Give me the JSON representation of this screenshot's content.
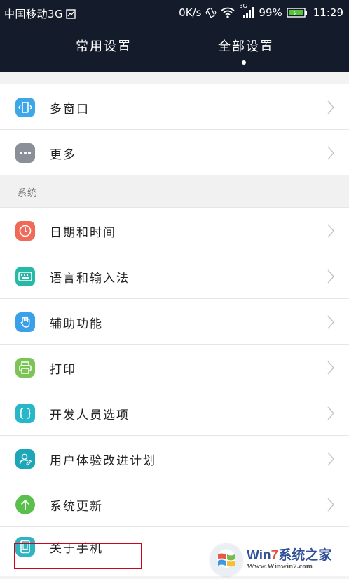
{
  "status_bar": {
    "carrier": "中国移动3G",
    "speed": "0K/s",
    "network": "3G",
    "battery": "99%",
    "time": "11:29"
  },
  "tabs": [
    {
      "label": "常用设置",
      "active": false
    },
    {
      "label": "全部设置",
      "active": true
    }
  ],
  "items_top": [
    {
      "label": "多窗口",
      "icon": "multi-window-icon",
      "color": "#3ea7e9"
    },
    {
      "label": "更多",
      "icon": "more-icon",
      "color": "#8a8f98"
    }
  ],
  "section": {
    "label": "系统"
  },
  "items_system": [
    {
      "label": "日期和时间",
      "icon": "clock-icon",
      "color": "#f06a5a"
    },
    {
      "label": "语言和输入法",
      "icon": "keyboard-icon",
      "color": "#26b9a6"
    },
    {
      "label": "辅助功能",
      "icon": "hand-icon",
      "color": "#3aa0ea"
    },
    {
      "label": "打印",
      "icon": "printer-icon",
      "color": "#7cc455"
    },
    {
      "label": "开发人员选项",
      "icon": "braces-icon",
      "color": "#27b7c8"
    },
    {
      "label": "用户体验改进计划",
      "icon": "user-icon",
      "color": "#1da6b8"
    },
    {
      "label": "系统更新",
      "icon": "arrow-up-icon",
      "color": "#5bbf4e"
    },
    {
      "label": "关于手机",
      "icon": "phone-icon",
      "color": "#2fb4c2"
    }
  ],
  "watermark": {
    "brand_prefix": "Win",
    "brand_seven": "7",
    "brand_suffix": "系统之家",
    "url": "Www.Winwin7.com"
  }
}
